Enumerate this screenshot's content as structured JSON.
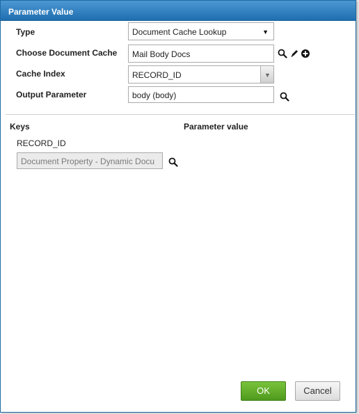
{
  "dialog": {
    "title": "Parameter Value"
  },
  "form": {
    "type_label": "Type",
    "type_value": "Document Cache Lookup",
    "doc_cache_label": "Choose Document Cache",
    "doc_cache_value": "Mail Body Docs",
    "cache_index_label": "Cache Index",
    "cache_index_value": "RECORD_ID",
    "output_param_label": "Output Parameter",
    "output_param_value": "body (body)"
  },
  "keys_table": {
    "keys_header": "Keys",
    "param_value_header": "Parameter value",
    "rows": [
      {
        "key": "RECORD_ID",
        "value": "Document Property - Dynamic Docu"
      }
    ]
  },
  "buttons": {
    "ok_label": "OK",
    "cancel_label": "Cancel"
  },
  "icons": {
    "search": "search-icon",
    "edit": "pencil-icon",
    "add": "plus-circle-icon",
    "dropdown": "caret-down-icon"
  },
  "colors": {
    "titlebar": "#2a7bbd",
    "ok_button": "#5fad28",
    "cancel_button": "#e6e6e6"
  }
}
